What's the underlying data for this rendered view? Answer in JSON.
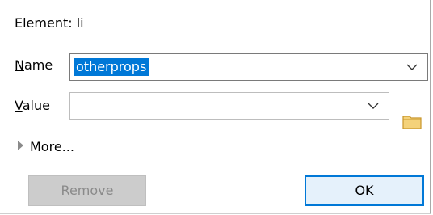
{
  "dialog": {
    "element_label": "Element: li",
    "name_label": "Name",
    "name_access_key": "N",
    "name_value": "otherprops",
    "value_label": "Value",
    "value_access_key": "V",
    "value_value": "",
    "more_label": "More...",
    "remove_label": "Remove",
    "remove_access_key": "R",
    "ok_label": "OK"
  },
  "icons": {
    "name_dropdown": "chevron-down-icon",
    "value_dropdown": "chevron-down-icon",
    "browse": "folder-icon",
    "expand": "triangle-right-icon"
  },
  "colors": {
    "selection": "#0078d7",
    "ok_border": "#0078d7",
    "ok_background": "#e5f1fb",
    "disabled_button": "#cccccc",
    "folder": "#e8b54b"
  }
}
